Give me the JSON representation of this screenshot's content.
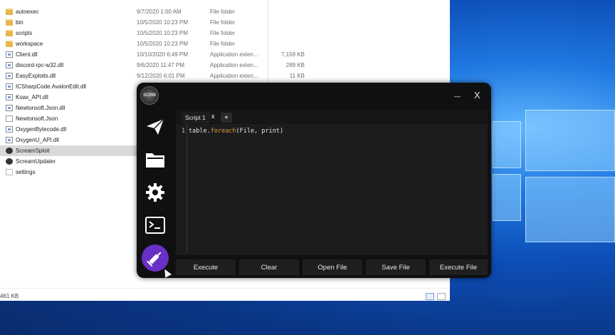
{
  "explorer": {
    "files": [
      {
        "name": "autoexec",
        "date": "9/7/2020 1:00 AM",
        "type": "File folder",
        "size": "",
        "icon": "folder"
      },
      {
        "name": "bin",
        "date": "10/5/2020 10:23 PM",
        "type": "File folder",
        "size": "",
        "icon": "folder"
      },
      {
        "name": "scripts",
        "date": "10/5/2020 10:23 PM",
        "type": "File folder",
        "size": "",
        "icon": "folder"
      },
      {
        "name": "workspace",
        "date": "10/5/2020 10:23 PM",
        "type": "File folder",
        "size": "",
        "icon": "folder"
      },
      {
        "name": "Client.dll",
        "date": "10/10/2020 6:49 PM",
        "type": "Application exten...",
        "size": "7,159 KB",
        "icon": "dll"
      },
      {
        "name": "discord-rpc-w32.dll",
        "date": "9/6/2020 11:47 PM",
        "type": "Application exten...",
        "size": "289 KB",
        "icon": "dll"
      },
      {
        "name": "EasyExploits.dll",
        "date": "9/12/2020 6:01 PM",
        "type": "Application exten...",
        "size": "11 KB",
        "icon": "dll"
      },
      {
        "name": "ICSharpCode.AvalonEdit.dll",
        "date": "",
        "type": "",
        "size": "",
        "icon": "dll"
      },
      {
        "name": "Koax_API.dll",
        "date": "",
        "type": "",
        "size": "",
        "icon": "dll"
      },
      {
        "name": "Newtonsoft.Json.dll",
        "date": "",
        "type": "",
        "size": "",
        "icon": "dll"
      },
      {
        "name": "Newtonsoft.Json",
        "date": "",
        "type": "",
        "size": "",
        "icon": "json"
      },
      {
        "name": "OxygenBytecode.dll",
        "date": "",
        "type": "",
        "size": "",
        "icon": "dll"
      },
      {
        "name": "OxygenU_API.dll",
        "date": "",
        "type": "",
        "size": "",
        "icon": "dll"
      },
      {
        "name": "ScreamSploit",
        "date": "",
        "type": "",
        "size": "",
        "icon": "exe",
        "selected": true
      },
      {
        "name": "ScreamUpdater",
        "date": "",
        "type": "",
        "size": "",
        "icon": "exe"
      },
      {
        "name": "settings",
        "date": "",
        "type": "",
        "size": "",
        "icon": "settings"
      }
    ],
    "status_text": "461 KB"
  },
  "executor": {
    "logo_text": "SCRM",
    "minimize_label": "—",
    "close_label": "X",
    "sidebar": [
      {
        "icon": "paper-plane-icon"
      },
      {
        "icon": "folder-icon"
      },
      {
        "icon": "gear-icon"
      },
      {
        "icon": "terminal-icon"
      },
      {
        "icon": "syringe-icon",
        "active": true
      }
    ],
    "tab": {
      "label": "Script 1",
      "close": "x",
      "add": "+"
    },
    "editor": {
      "line_number": "1",
      "code_prefix": "table.",
      "code_keyword": "foreach",
      "code_suffix": "(File, print)"
    },
    "buttons": [
      "Execute",
      "Clear",
      "Open File",
      "Save File",
      "Execute File"
    ],
    "accent_color": "#6a2fc4",
    "keyword_color": "#e59a3a"
  }
}
